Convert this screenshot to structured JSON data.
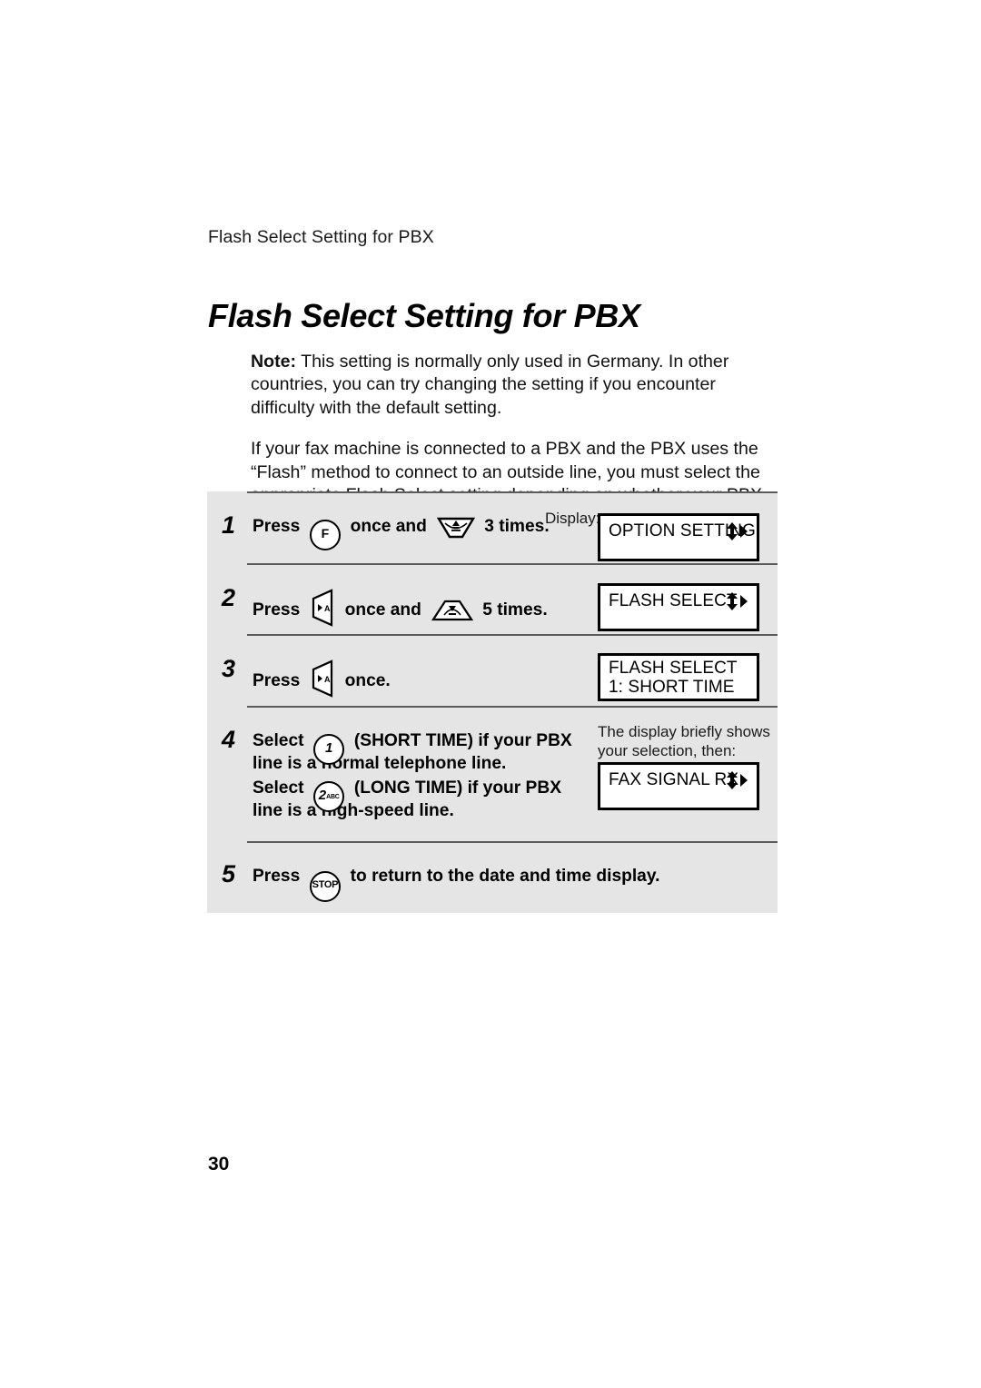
{
  "page": {
    "running_head": "Flash Select Setting for PBX",
    "title": "Flash Select Setting for PBX",
    "folio": "30"
  },
  "body": {
    "note_label": "Note:",
    "note_text": " This setting is normally only used in Germany. In other countries, you can try changing the setting if you encounter difficulty with the default setting.",
    "paragraph_2": "If your fax machine is connected to a PBX and the PBX uses the “Flash” method to connect to an outside line, you must select the appropriate Flash Select setting depending on whether your PBX line is a normal telephone line or a high-speed line."
  },
  "procedure": {
    "display_label": "Display:",
    "steps": [
      {
        "number": "1",
        "text_before_key1": "Press",
        "key1": "F",
        "text_between": "once  and",
        "key2": "down-trapezoid-key",
        "text_after": "3 times.",
        "lcd_line1": "OPTION SETTING",
        "lcd_line2": "",
        "lcd_arrows": true
      },
      {
        "number": "2",
        "text_before_key1": "Press",
        "key1": "left-wedge-key",
        "text_between": "once and",
        "key2": "up-trapezoid-key",
        "text_after": "5 times.",
        "lcd_line1": "FLASH SELECT",
        "lcd_line2": "",
        "lcd_arrows": true
      },
      {
        "number": "3",
        "text_before_key1": "Press",
        "key1": "left-wedge-key",
        "text_after": "once.",
        "lcd_line1": "FLASH SELECT",
        "lcd_line2": "1: SHORT TIME",
        "lcd_arrows": false
      },
      {
        "number": "4",
        "line1_a": "Select",
        "key_1": "1",
        "line1_b": "(SHORT TIME) if your PBX",
        "line2": "line is a normal telephone line.",
        "line3_a": "Select",
        "key_2": "2",
        "key_2_sub": "ABC",
        "line3_b": "(LONG TIME) if your PBX",
        "line4": "line is a high-speed line.",
        "hint_line1": "The display briefly shows",
        "hint_line2": "your selection, then:",
        "lcd_line1": "FAX SIGNAL RX",
        "lcd_line2": "",
        "lcd_arrows": true
      },
      {
        "number": "5",
        "text_before_key1": "Press",
        "key1": "STOP",
        "text_after": "to return to the date and time display."
      }
    ]
  },
  "colors": {
    "panel_background": "#e5e5e5",
    "rule": "#5b5b5b",
    "text": "#000000",
    "page_background": "#ffffff"
  }
}
